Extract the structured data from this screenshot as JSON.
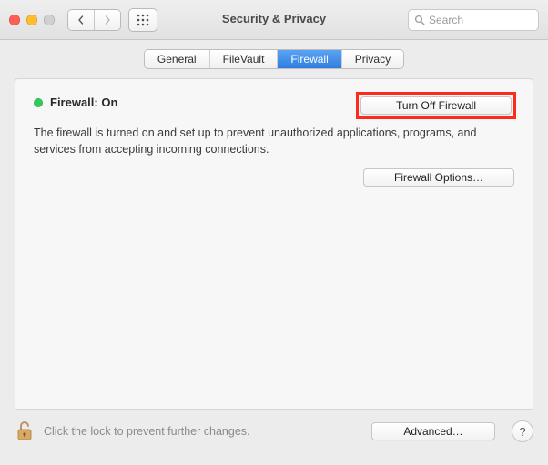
{
  "window": {
    "title": "Security & Privacy",
    "search_placeholder": "Search"
  },
  "tabs": {
    "general": "General",
    "filevault": "FileVault",
    "firewall": "Firewall",
    "privacy": "Privacy"
  },
  "firewall": {
    "status_label": "Firewall: On",
    "turn_off_label": "Turn Off Firewall",
    "description": "The firewall is turned on and set up to prevent unauthorized applications, programs, and services from accepting incoming connections.",
    "options_label": "Firewall Options…"
  },
  "footer": {
    "lock_text": "Click the lock to prevent further changes.",
    "advanced_label": "Advanced…",
    "help_label": "?"
  }
}
